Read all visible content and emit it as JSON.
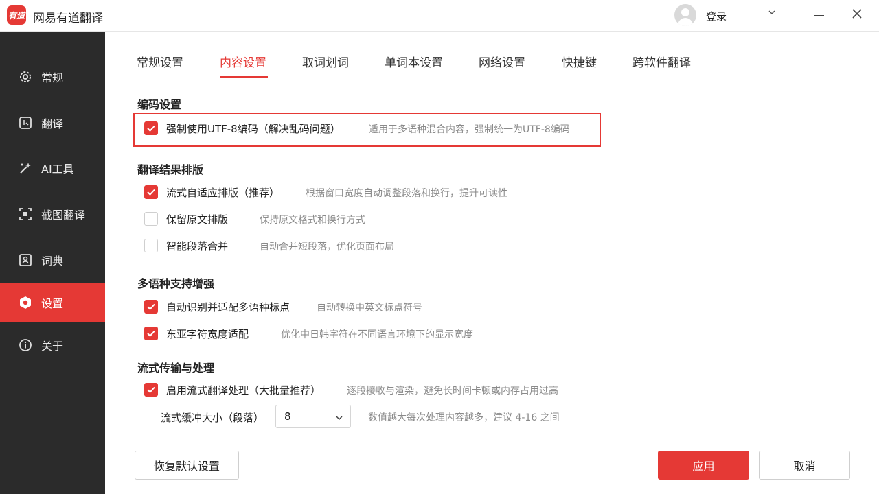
{
  "app": {
    "title": "网易有道翻译",
    "logo_text": "有道"
  },
  "titlebar": {
    "login": "登录"
  },
  "sidebar": {
    "items": [
      {
        "label": "常规",
        "icon": "gear-icon"
      },
      {
        "label": "翻译",
        "icon": "translate-icon"
      },
      {
        "label": "AI工具",
        "icon": "ai-tools-icon"
      },
      {
        "label": "截图翻译",
        "icon": "screenshot-icon"
      },
      {
        "label": "词典",
        "icon": "dictionary-icon"
      },
      {
        "label": "设置",
        "icon": "settings-icon",
        "active": true
      },
      {
        "label": "关于",
        "icon": "info-icon"
      }
    ]
  },
  "tabs": [
    {
      "label": "常规设置"
    },
    {
      "label": "内容设置",
      "active": true
    },
    {
      "label": "取词划词"
    },
    {
      "label": "单词本设置"
    },
    {
      "label": "网络设置"
    },
    {
      "label": "快捷键"
    },
    {
      "label": "跨软件翻译"
    }
  ],
  "sections": {
    "encoding": {
      "title": "编码设置",
      "utf8": {
        "label": "强制使用UTF-8编码（解决乱码问题）",
        "desc": "适用于多语种混合内容，强制统一为UTF-8编码",
        "checked": true
      }
    },
    "layout": {
      "title": "翻译结果排版",
      "adaptive": {
        "label": "流式自适应排版（推荐）",
        "desc": "根据窗口宽度自动调整段落和换行，提升可读性",
        "checked": true
      },
      "keep_original": {
        "label": "保留原文排版",
        "desc": "保持原文格式和换行方式",
        "checked": false
      },
      "merge": {
        "label": "智能段落合并",
        "desc": "自动合并短段落，优化页面布局",
        "checked": false
      }
    },
    "multilang": {
      "title": "多语种支持增强",
      "punct": {
        "label": "自动识别并适配多语种标点",
        "desc": "自动转换中英文标点符号",
        "checked": true
      },
      "cjk_width": {
        "label": "东亚字符宽度适配",
        "desc": "优化中日韩字符在不同语言环境下的显示宽度",
        "checked": true
      }
    },
    "streaming": {
      "title": "流式传输与处理",
      "enable": {
        "label": "启用流式翻译处理（大批量推荐）",
        "desc": "逐段接收与渲染，避免长时间卡顿或内存占用过高",
        "checked": true
      },
      "buffer": {
        "label": "流式缓冲大小（段落）",
        "value": "8",
        "desc": "数值越大每次处理内容越多，建议 4-16 之间"
      }
    }
  },
  "footer": {
    "restore": "恢复默认设置",
    "apply": "应用",
    "cancel": "取消"
  },
  "colors": {
    "accent": "#e53935",
    "sidebar_bg": "#2b2b2b"
  }
}
